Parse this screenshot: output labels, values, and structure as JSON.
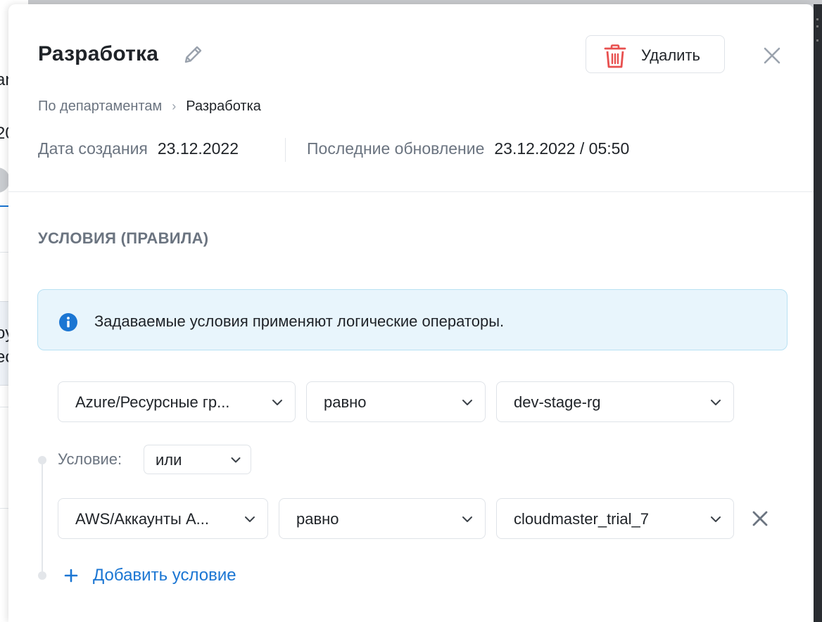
{
  "header": {
    "title": "Разработка",
    "delete_label": "Удалить"
  },
  "breadcrumb": {
    "parent": "По департаментам",
    "separator": "›",
    "current": "Разработка"
  },
  "meta": {
    "created_label": "Дата создания",
    "created_value": "23.12.2022",
    "updated_label": "Последние обновление",
    "updated_value": "23.12.2022 / 05:50"
  },
  "conditions": {
    "title": "УСЛОВИЯ (ПРАВИЛА)",
    "info_text": "Задаваемые условия применяют логические операторы.",
    "rows": [
      {
        "field": "Azure/Ресурсные гр...",
        "operator": "равно",
        "value": "dev-stage-rg"
      },
      {
        "field": "AWS/Аккаунты A...",
        "operator": "равно",
        "value": "cloudmaster_trial_7"
      }
    ],
    "logic_label": "Условие:",
    "logic_value": "или",
    "add_label": "Добавить условие"
  },
  "colors": {
    "accent": "#1b76d3",
    "danger": "#e8504f",
    "info_bg": "#e8f5fc",
    "info_border": "#b8e1f3",
    "muted_text": "#6b7480"
  },
  "icons": {
    "edit": "pencil-icon",
    "delete": "trash-icon",
    "close": "close-icon",
    "info": "info-icon",
    "dropdown": "chevron-down-icon",
    "remove_row": "close-icon",
    "add": "plus-icon"
  },
  "background_fragments": [
    "an",
    "20",
    "oy",
    "ec"
  ]
}
